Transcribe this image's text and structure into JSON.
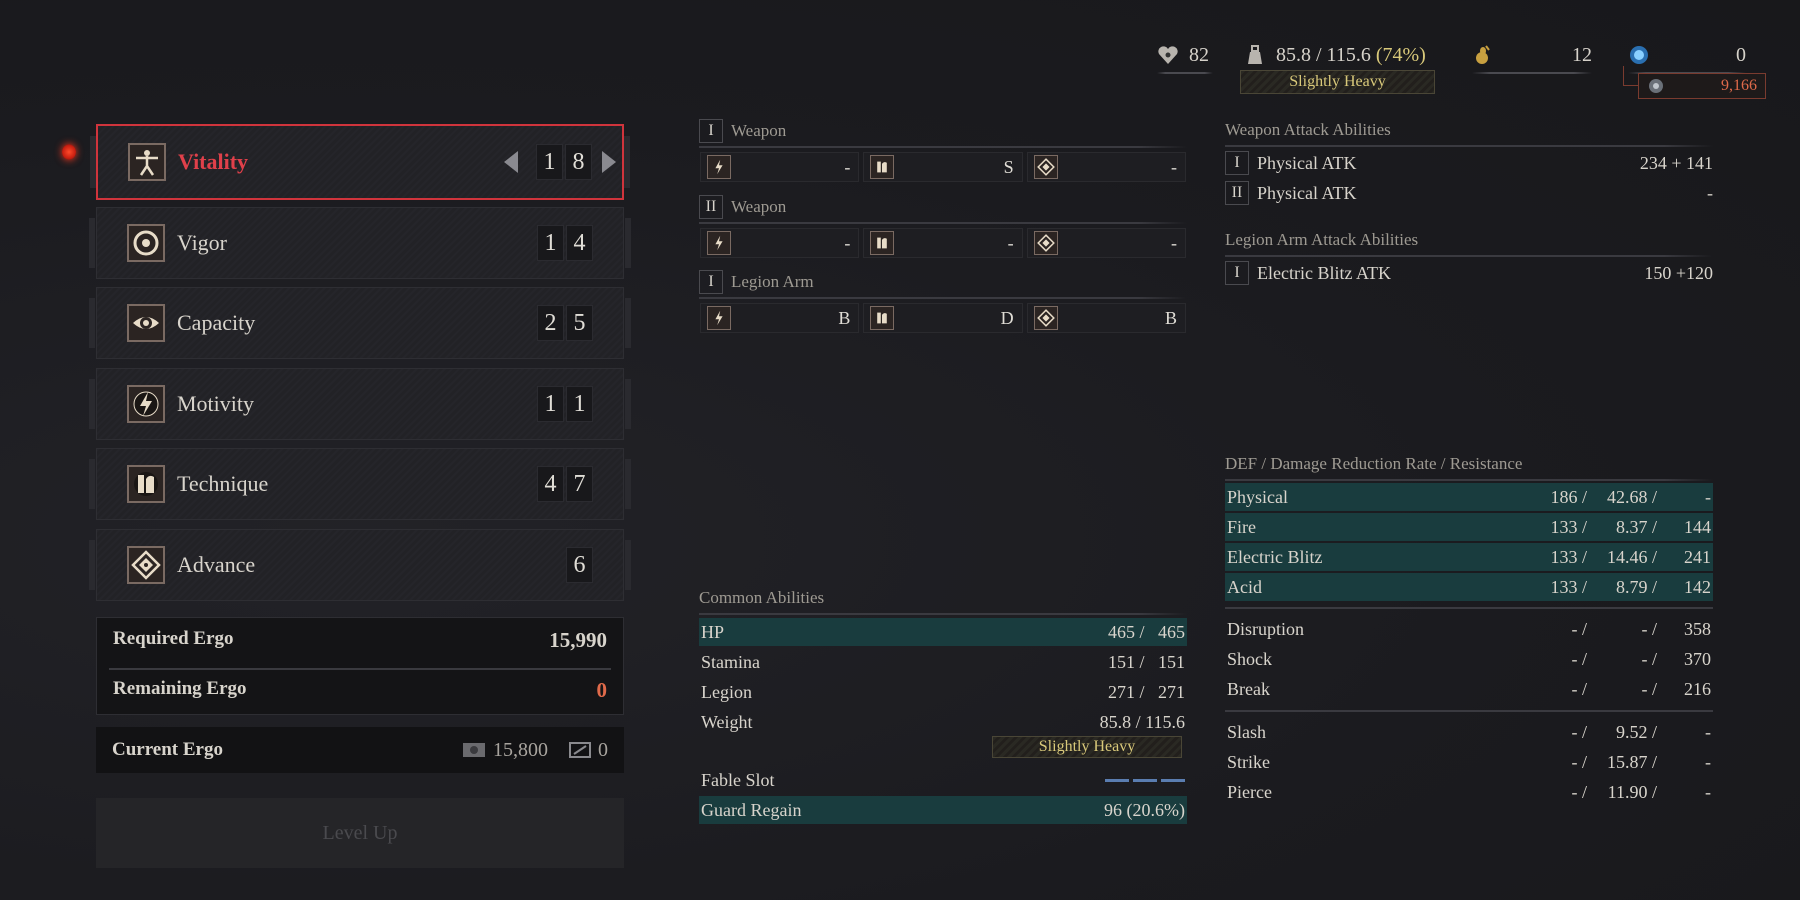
{
  "top_bar": {
    "level": {
      "icon": "heart-level-icon",
      "value": "82"
    },
    "weight": {
      "icon": "weight-icon",
      "value": "85.8 / 115.6",
      "percent": "(74%)",
      "status": "Slightly Heavy"
    },
    "consumable": {
      "icon": "gold-item-icon",
      "value": "12"
    },
    "ergo_item": {
      "icon": "blue-ergo-icon",
      "value": "0"
    },
    "lost_ergo": {
      "icon": "lost-ergo-icon",
      "value": "9,166"
    }
  },
  "stats": [
    {
      "label": "Vitality",
      "icon": "vitruvian-icon",
      "digits": [
        "1",
        "8"
      ],
      "selected": true
    },
    {
      "label": "Vigor",
      "icon": "vigor-circle-icon",
      "digits": [
        "1",
        "4"
      ],
      "selected": false
    },
    {
      "label": "Capacity",
      "icon": "eye-icon",
      "digits": [
        "2",
        "5"
      ],
      "selected": false
    },
    {
      "label": "Motivity",
      "icon": "lightning-icon",
      "digits": [
        "1",
        "1"
      ],
      "selected": false
    },
    {
      "label": "Technique",
      "icon": "chess-icon",
      "digits": [
        "4",
        "7"
      ],
      "selected": false
    },
    {
      "label": "Advance",
      "icon": "diamond-icon",
      "digits": [
        "6"
      ],
      "selected": false
    }
  ],
  "ergo": {
    "required_label": "Required Ergo",
    "required_value": "15,990",
    "remaining_label": "Remaining Ergo",
    "remaining_value": "0",
    "current_label": "Current Ergo",
    "current_value": "15,800",
    "secondary_value": "0",
    "remaining_color": "#e06a4a"
  },
  "level_up_label": "Level Up",
  "scaling": [
    {
      "roman": "I",
      "label": "Weapon",
      "grades": [
        "-",
        "S",
        "-"
      ]
    },
    {
      "roman": "II",
      "label": "Weapon",
      "grades": [
        "-",
        "-",
        "-"
      ]
    },
    {
      "roman": "I",
      "label": "Legion Arm",
      "grades": [
        "B",
        "D",
        "B"
      ]
    }
  ],
  "common_abilities": {
    "title": "Common Abilities",
    "rows": [
      {
        "label": "HP",
        "value": "465 /   465",
        "highlight": true
      },
      {
        "label": "Stamina",
        "value": "151 /   151",
        "highlight": false
      },
      {
        "label": "Legion",
        "value": "271 /   271",
        "highlight": false
      },
      {
        "label": "Weight",
        "value": "85.8 / 115.6",
        "highlight": false
      }
    ],
    "weight_status": "Slightly Heavy",
    "fable_label": "Fable Slot",
    "fable_slots": 3,
    "guard_label": "Guard Regain",
    "guard_value": "96 (20.6%)"
  },
  "weapon_attack": {
    "title": "Weapon Attack Abilities",
    "rows": [
      {
        "roman": "I",
        "label": "Physical ATK",
        "value": "234 + 141"
      },
      {
        "roman": "II",
        "label": "Physical ATK",
        "value": "-"
      }
    ]
  },
  "legion_attack": {
    "title": "Legion Arm Attack Abilities",
    "rows": [
      {
        "roman": "I",
        "label": "Electric Blitz ATK",
        "value": "150 +120"
      }
    ]
  },
  "defense": {
    "title": "DEF / Damage Reduction Rate / Resistance",
    "elemental": [
      {
        "label": "Physical",
        "def": "186 /",
        "rate": "42.68 /",
        "res": "-"
      },
      {
        "label": "Fire",
        "def": "133 /",
        "rate": "8.37 /",
        "res": "144"
      },
      {
        "label": "Electric Blitz",
        "def": "133 /",
        "rate": "14.46 /",
        "res": "241"
      },
      {
        "label": "Acid",
        "def": "133 /",
        "rate": "8.79 /",
        "res": "142"
      }
    ],
    "status": [
      {
        "label": "Disruption",
        "def": "- /",
        "rate": "- /",
        "res": "358"
      },
      {
        "label": "Shock",
        "def": "- /",
        "rate": "- /",
        "res": "370"
      },
      {
        "label": "Break",
        "def": "- /",
        "rate": "- /",
        "res": "216"
      }
    ],
    "physical_types": [
      {
        "label": "Slash",
        "def": "- /",
        "rate": "9.52 /",
        "res": "-"
      },
      {
        "label": "Strike",
        "def": "- /",
        "rate": "15.87 /",
        "res": "-"
      },
      {
        "label": "Pierce",
        "def": "- /",
        "rate": "11.90 /",
        "res": "-"
      }
    ]
  },
  "colors": {
    "selected_border": "#d0343c",
    "highlight_row": "#193c3e",
    "status_yellow": "#d9c97a",
    "lost_ergo": "#e06a4a"
  }
}
